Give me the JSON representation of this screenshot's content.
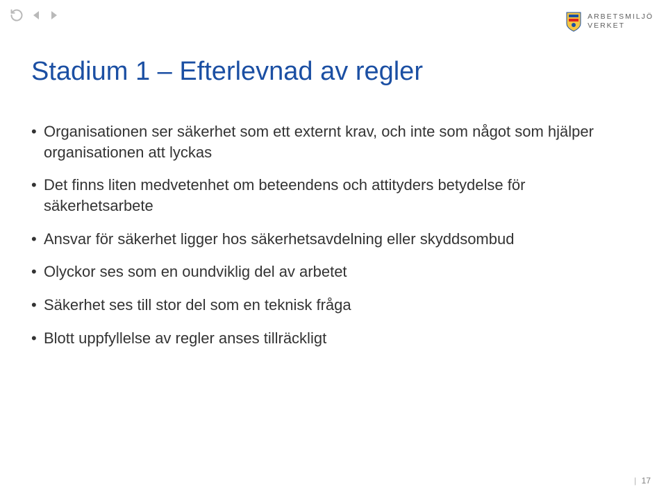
{
  "header": {
    "controls": {
      "refresh": "refresh",
      "prev": "prev",
      "next": "next"
    },
    "logo": {
      "line1": "ARBETSMILJÖ",
      "line2": "VERKET"
    }
  },
  "slide": {
    "title": "Stadium 1 – Efterlevnad av regler",
    "bullets": [
      "Organisationen ser säkerhet som ett externt krav, och inte som något som hjälper organisationen att lyckas",
      "Det finns liten medvetenhet om beteendens och attityders betydelse för säkerhetsarbete",
      "Ansvar för säkerhet ligger hos säkerhetsavdelning eller skyddsombud",
      "Olyckor ses som en oundviklig del av arbetet",
      "Säkerhet ses till stor del som en teknisk fråga",
      "Blott uppfyllelse av regler anses tillräckligt"
    ]
  },
  "footer": {
    "page_number": "17"
  }
}
